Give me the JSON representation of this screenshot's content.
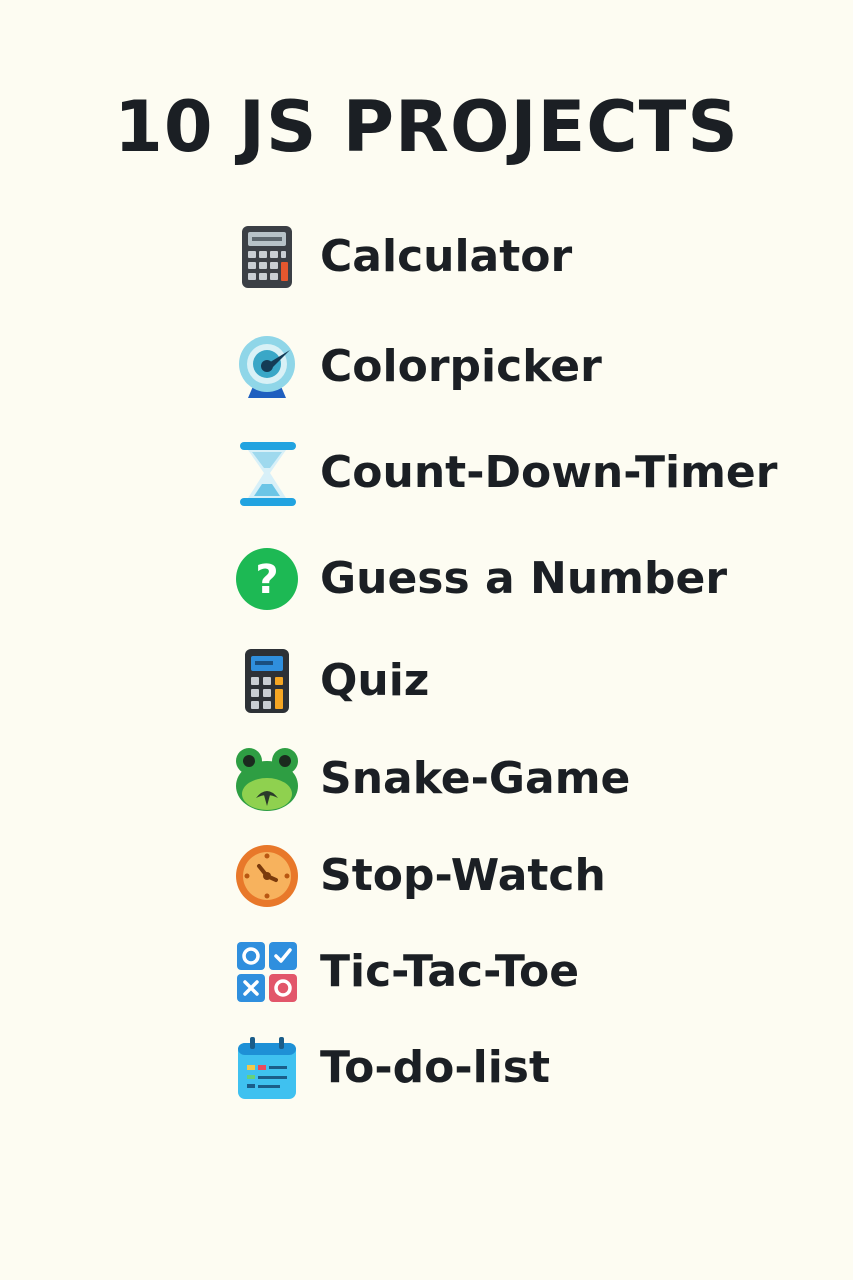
{
  "title": "10 JS PROJECTS",
  "projects": [
    {
      "label": "Calculator",
      "icon": "calculator-icon"
    },
    {
      "label": "Colorpicker",
      "icon": "gauge-icon"
    },
    {
      "label": "Count-Down-Timer",
      "icon": "hourglass-icon"
    },
    {
      "label": "Guess a Number",
      "icon": "question-mark-icon"
    },
    {
      "label": "Quiz",
      "icon": "calculator-icon"
    },
    {
      "label": "Snake-Game",
      "icon": "frog-face-icon"
    },
    {
      "label": "Stop-Watch",
      "icon": "stopwatch-icon"
    },
    {
      "label": "Tic-Tac-Toe",
      "icon": "tic-tac-toe-icon"
    },
    {
      "label": "To-do-list",
      "icon": "calendar-list-icon"
    }
  ]
}
